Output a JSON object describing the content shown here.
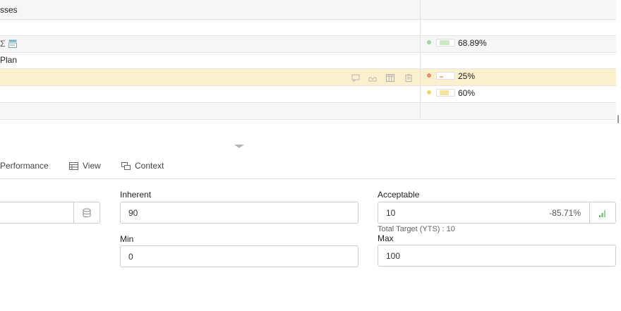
{
  "grid": {
    "rows": [
      {
        "label": "sses"
      },
      {
        "label": ""
      },
      {
        "label": "",
        "status_color": "#9fd89a",
        "bar_color": "#cde8c6",
        "progress": 0.6889,
        "percent": "68.89%"
      },
      {
        "label": "Plan"
      },
      {
        "label": "",
        "status_color": "#ee8a6e",
        "bar_color": "#f6b08a",
        "progress": 0.25,
        "percent": "25%"
      },
      {
        "label": "",
        "status_color": "#f4d36a",
        "bar_color": "#f5e49a",
        "progress": 0.6,
        "percent": "60%"
      },
      {
        "label": ""
      }
    ],
    "row_icons": [
      "sum-icon",
      "form-icon",
      "comment-icon",
      "inbox-icon",
      "columns-icon",
      "clipboard-icon"
    ]
  },
  "tabs": [
    {
      "label": "Performance"
    },
    {
      "label": "View",
      "icon": "view-icon"
    },
    {
      "label": "Context",
      "icon": "context-icon"
    }
  ],
  "form": {
    "inherent": {
      "label": "Inherent",
      "value": "90"
    },
    "acceptable": {
      "label": "Acceptable",
      "value": "10",
      "variance": "-85.71%"
    },
    "total_target": "Total Target (YTS) : 10",
    "min": {
      "label": "Min",
      "value": "0"
    },
    "max": {
      "label": "Max",
      "value": "100"
    }
  },
  "colors": {
    "highlight_row": "#faf0cd",
    "alt_row": "#f6f6f6",
    "accent_green": "#5cb85c"
  }
}
